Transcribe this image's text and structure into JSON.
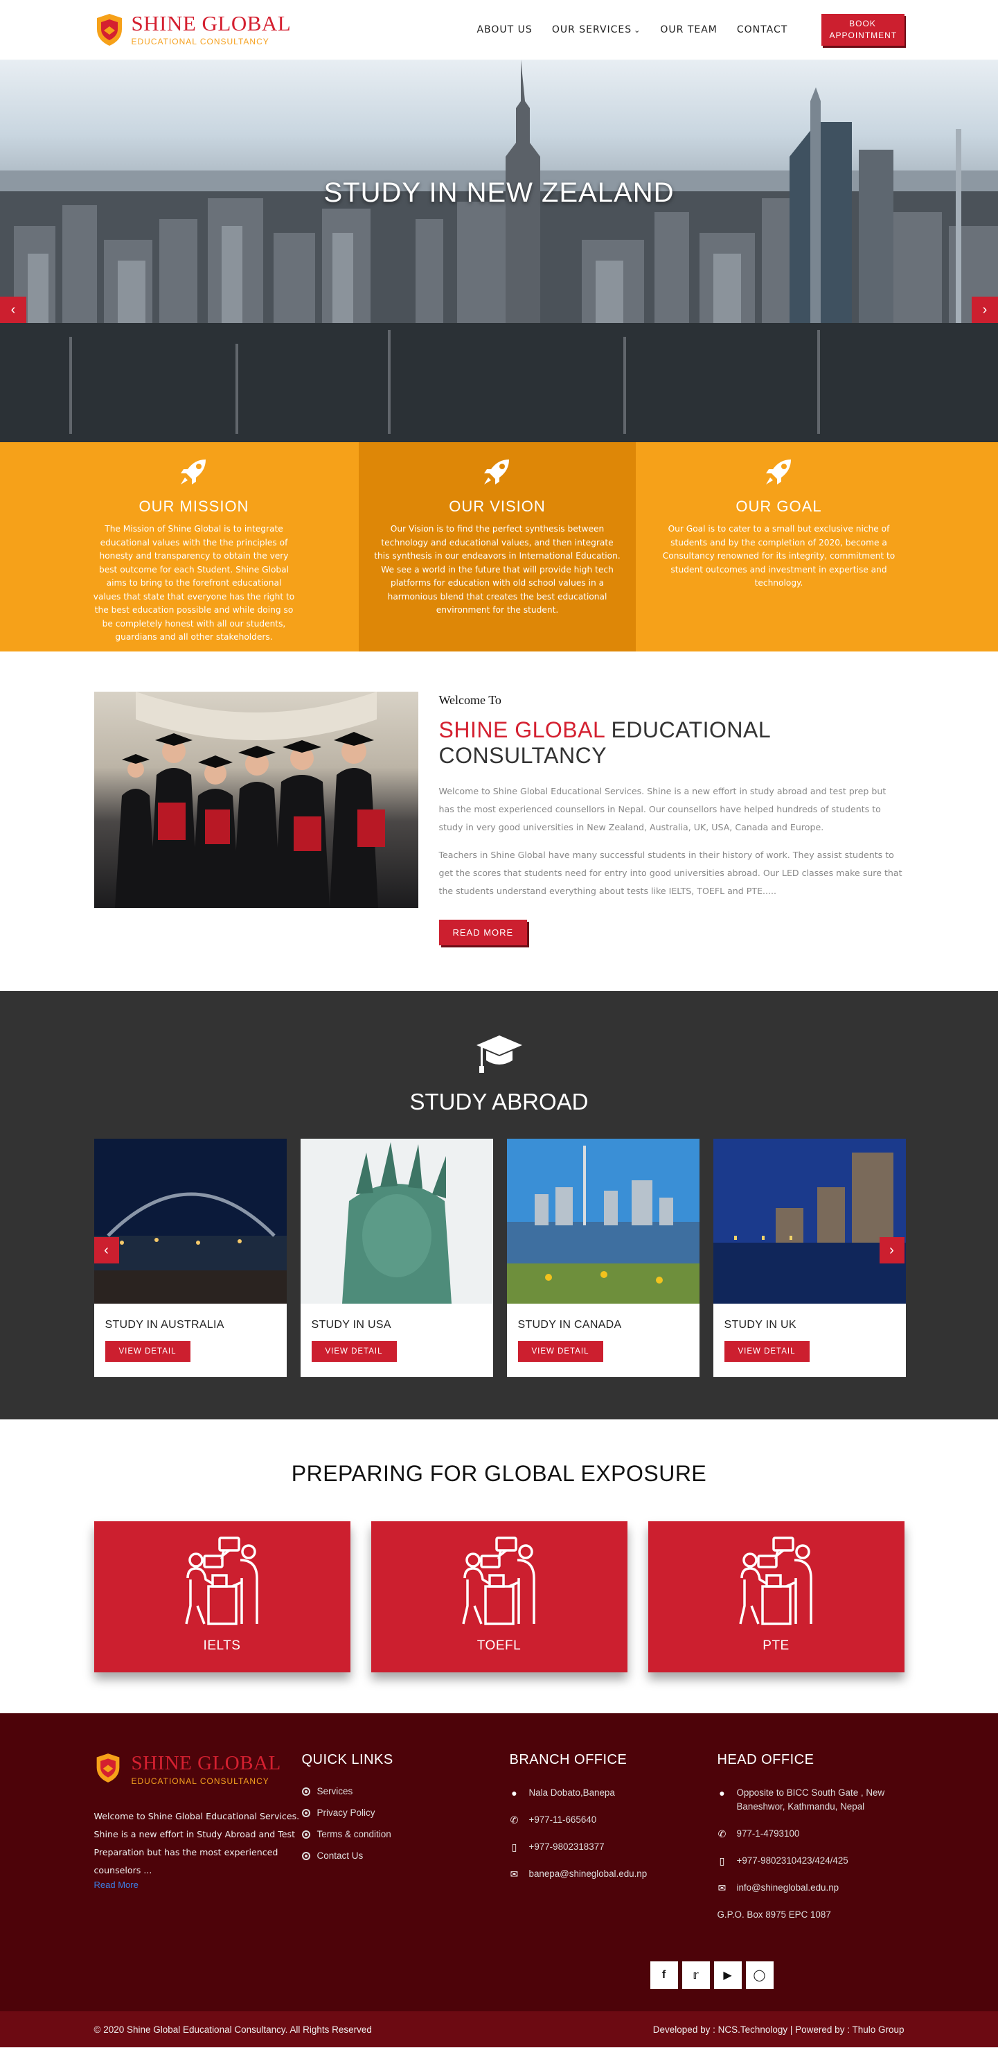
{
  "brand": {
    "name": "SHINE GLOBAL",
    "tagline": "EDUCATIONAL CONSULTANCY",
    "primary_color": "#cc1f2f",
    "accent_color": "#f6a119"
  },
  "nav": {
    "items": [
      "ABOUT US",
      "OUR SERVICES",
      "OUR TEAM",
      "CONTACT"
    ],
    "book_label": "BOOK APPOINTMENT"
  },
  "hero": {
    "title": "STUDY IN NEW ZEALAND",
    "prev_icon": "chevron-left-icon",
    "next_icon": "chevron-right-icon"
  },
  "mission": [
    {
      "title": "OUR MISSION",
      "text": "The Mission of Shine Global is to integrate educational values with the the principles of honesty and transparency to obtain the very best outcome for each Student. Shine Global aims to bring to the forefront educational values that state that everyone has the right to the best education possible and while doing so be completely honest with all our students, guardians and all other stakeholders."
    },
    {
      "title": "OUR VISION",
      "text": "Our Vision is to find the perfect synthesis between technology and educational values, and then integrate this synthesis in our endeavors in International Education. We see a world in the future that will provide high tech platforms for education with old school values in a harmonious blend that creates the best educational environment for the student."
    },
    {
      "title": "OUR GOAL",
      "text": "Our Goal is to cater to a small but exclusive niche of students and by the completion of 2020, become a Consultancy renowned for its integrity, commitment to student outcomes and investment in expertise and technology."
    }
  ],
  "welcome": {
    "kicker": "Welcome To",
    "heading_red": "SHINE GLOBAL",
    "heading_rest": " EDUCATIONAL CONSULTANCY",
    "p1": "Welcome to Shine Global Educational Services. Shine is a new effort in study abroad and test prep but has the most experienced counsellors in Nepal. Our counsellors have helped hundreds of students to study in very good universities in New Zealand, Australia, UK, USA, Canada and Europe.",
    "p2": "Teachers in Shine Global have many successful students in their history of work. They assist students to get the scores that students need for entry into good universities abroad. Our LED classes make sure that the students understand everything about tests like IELTS, TOEFL and PTE.....",
    "button": "READ MORE"
  },
  "abroad": {
    "title": "STUDY ABROAD",
    "cards": [
      {
        "title": "STUDY IN AUSTRALIA",
        "button": "VIEW DETAIL"
      },
      {
        "title": "STUDY IN USA",
        "button": "VIEW DETAIL"
      },
      {
        "title": "STUDY IN CANADA",
        "button": "VIEW DETAIL"
      },
      {
        "title": "STUDY IN UK",
        "button": "VIEW DETAIL"
      }
    ]
  },
  "prep": {
    "title": "PREPARING FOR GLOBAL EXPOSURE",
    "boxes": [
      "IELTS",
      "TOEFL",
      "PTE"
    ]
  },
  "footer": {
    "about": "Welcome to Shine Global Educational Services. Shine is a new effort in Study Abroad and Test Preparation but has the most experienced counselors ...",
    "read_more": "Read More",
    "quick_links_title": "QUICK LINKS",
    "quick_links": [
      "Services",
      "Privacy Policy",
      "Terms & condition",
      "Contact Us"
    ],
    "branch": {
      "title": "BRANCH OFFICE",
      "address": "Nala Dobato,Banepa",
      "phone": "+977-11-665640",
      "mobile": "+977-9802318377",
      "email": "banepa@shineglobal.edu.np"
    },
    "head": {
      "title": "HEAD OFFICE",
      "address": "Opposite to BICC South Gate , New Baneshwor, Kathmandu, Nepal",
      "phone": "977-1-4793100",
      "mobile": "+977-9802310423/424/425",
      "email": "info@shineglobal.edu.np",
      "pobox": "G.P.O. Box 8975 EPC 1087"
    },
    "social": [
      "f",
      "twitter-icon",
      "youtube-icon",
      "instagram-icon"
    ],
    "copyright": "© 2020 Shine Global Educational Consultancy. All Rights Reserved",
    "credits": "Developed by : NCS.Technology | Powered by : Thulo Group"
  }
}
